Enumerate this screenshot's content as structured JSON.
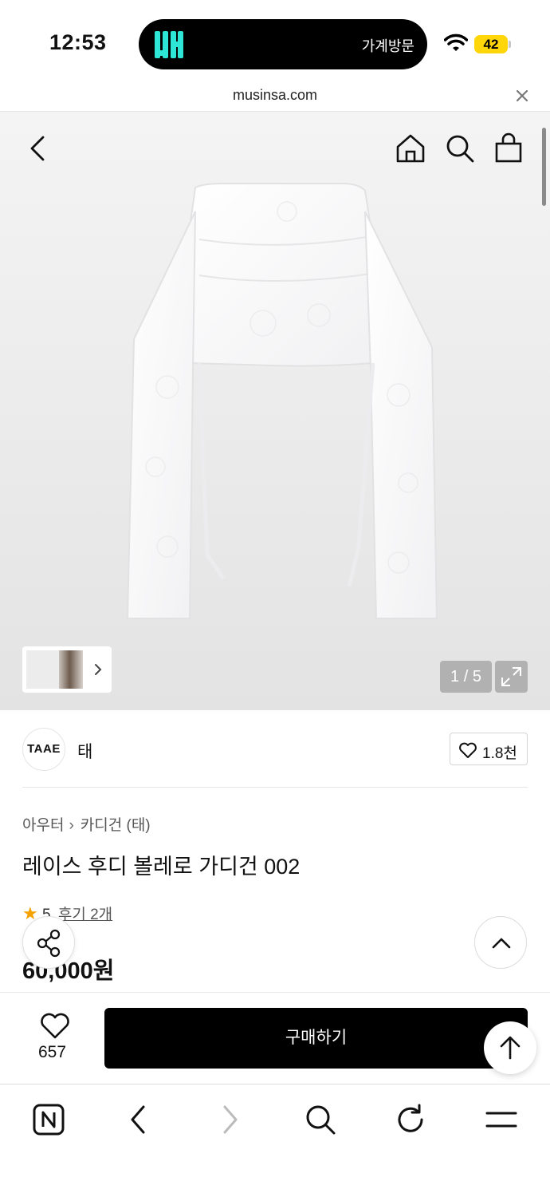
{
  "status_bar": {
    "time": "12:53",
    "island_app_text": "가계방문",
    "battery": "42"
  },
  "browser": {
    "url": "musinsa.com"
  },
  "gallery": {
    "counter": "1 / 5",
    "total_images": 5,
    "current_image": 1
  },
  "brand": {
    "logo_text": "TAAE",
    "name": "태",
    "like_count": "1.8천"
  },
  "product": {
    "breadcrumb": [
      "아우터",
      "카디건 (태)"
    ],
    "title": "레이스 후디 볼레로 가디건 002",
    "rating": "5",
    "review_label": "후기 2개",
    "price": "60,000원"
  },
  "purchase_bar": {
    "wish_count": "657",
    "buy_label": "구매하기"
  },
  "colors": {
    "accent_star": "#f5a100",
    "buy_button": "#000000",
    "battery": "#ffd60a",
    "island_logo": "#2ee6d6"
  }
}
